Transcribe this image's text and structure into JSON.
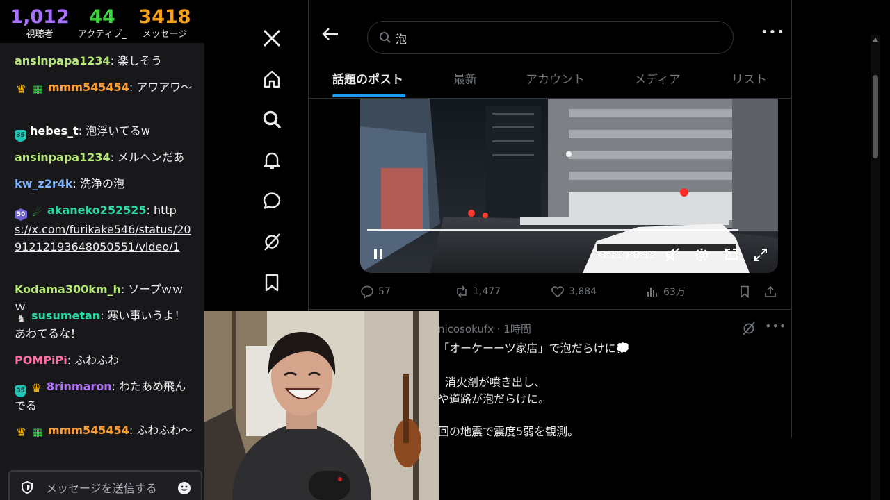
{
  "stats": {
    "viewers": {
      "value": "1,012",
      "label": "視聴者",
      "color": "#a970ff"
    },
    "active": {
      "value": "44",
      "label": "アクティブ_",
      "color": "#3fd33f"
    },
    "messages": {
      "value": "3418",
      "label": "メッセージ",
      "color": "#f6a01a"
    }
  },
  "chat": {
    "messages": [
      {
        "user": "ansinpapa1234",
        "color": "#b6e876",
        "text": ": 楽しそう"
      },
      {
        "user": "mmm545454",
        "color": "#ff9b2f",
        "text": ": アワアワ〜"
      },
      {
        "user": "hebes_t",
        "color": "#ffffff",
        "text": ": 泡浮いてるw"
      },
      {
        "user": "ansinpapa1234",
        "color": "#b6e876",
        "text": ": メルヘンだあ"
      },
      {
        "user": "kw_z2r4k",
        "color": "#7fb4ff",
        "text": ": 洗浄の泡"
      },
      {
        "user": "akaneko252525",
        "color": "#2ed6a0",
        "text": ":",
        "link": "https://x.com/furikake546/status/2091212193648050551/video/1"
      },
      {
        "user": "Kodama300km_h",
        "color": "#b6e876",
        "text": ": ソープｗｗｗ"
      },
      {
        "user": "susumetan",
        "color": "#2ed6a0",
        "text": ": 寒い事いうよ！あわてるな！"
      },
      {
        "user": "POMPiPi",
        "color": "#ff6fa3",
        "text": ": ふわふわ"
      },
      {
        "user": "8rinmaron",
        "color": "#b474ff",
        "text": ": わたあめ飛んでる"
      },
      {
        "user": "mmm545454",
        "color": "#ff9b2f",
        "text": ": ふわふわ〜"
      }
    ],
    "input_placeholder": "メッセージを送信する"
  },
  "x": {
    "search_value": "泡",
    "tabs": [
      "話題のポスト",
      "最新",
      "アカウント",
      "メディア",
      "リスト"
    ],
    "video": {
      "time": "0:11 / 0:12",
      "progress": 0.92
    },
    "actions": {
      "replies": "57",
      "reposts": "1,477",
      "likes": "3,884",
      "views": "63万"
    },
    "tweet2": {
      "header": "nicosokufx · 1時間",
      "line1": "「オーケーーツ家店」で泡だらけに💭",
      "line2": "消火剤が噴き出し、",
      "line3": "や道路が泡だらけに。",
      "line4": "回の地震で震度5弱を観測。"
    }
  }
}
